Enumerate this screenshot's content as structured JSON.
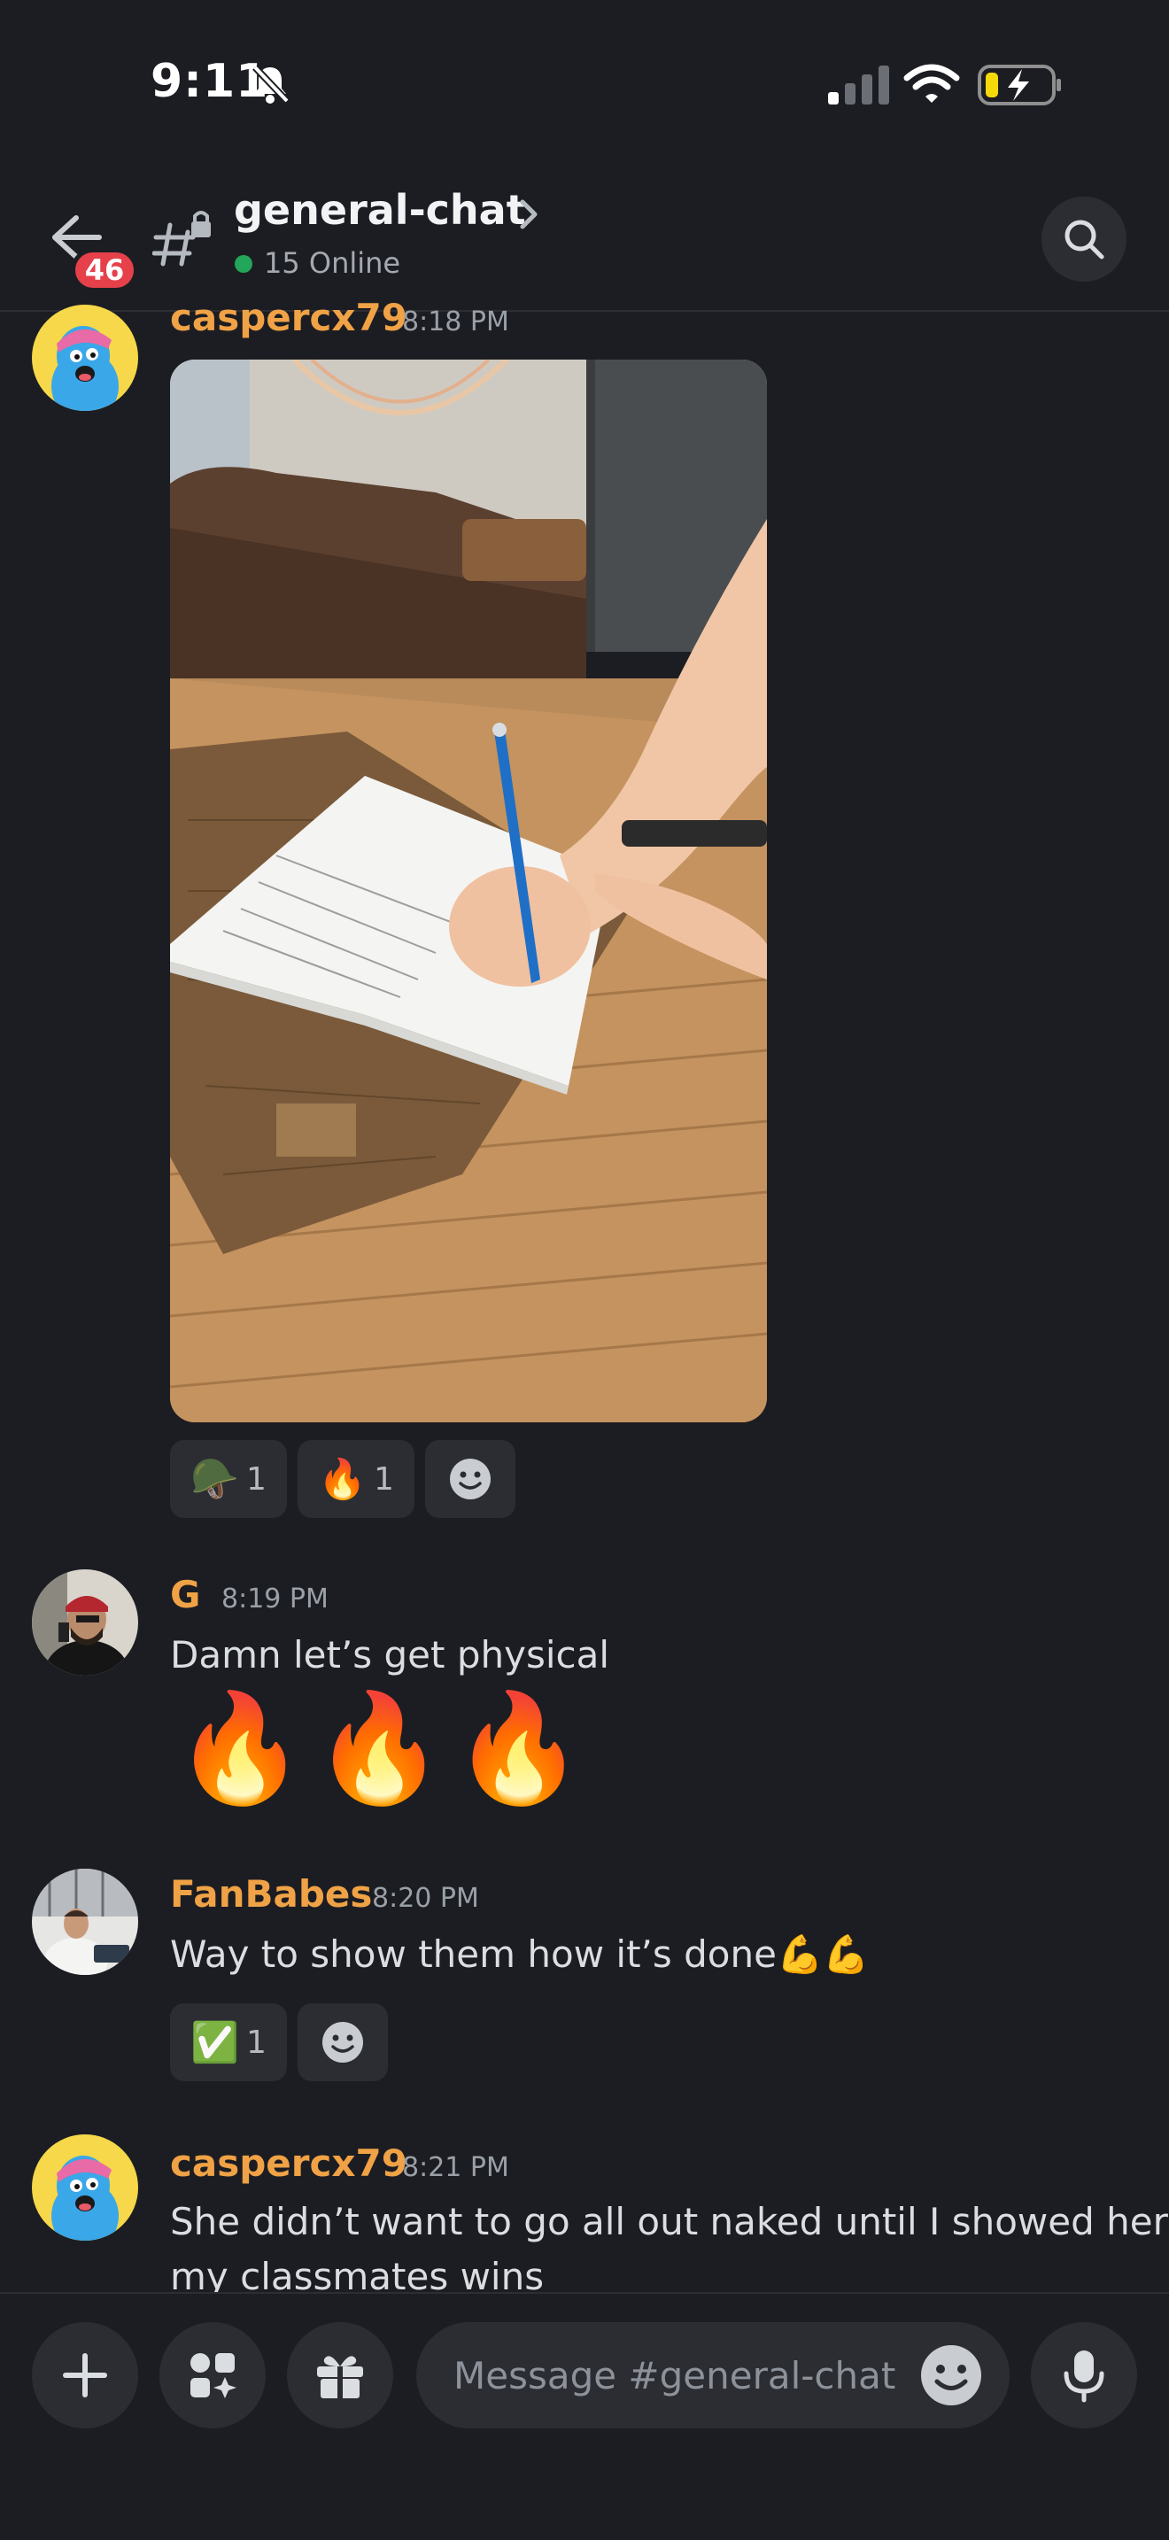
{
  "status_bar": {
    "time": "9:11"
  },
  "header": {
    "unread_badge": "46",
    "channel_name": "general-chat",
    "online_text": "15 Online"
  },
  "messages": [
    {
      "username": "caspercx79",
      "time": "8:18 PM",
      "reactions": [
        {
          "emoji": "🪖",
          "count": "1"
        },
        {
          "emoji": "🔥",
          "count": "1"
        }
      ]
    },
    {
      "username": "G",
      "time": "8:19 PM",
      "text": "Damn let’s get physical",
      "big_emoji": "🔥🔥🔥"
    },
    {
      "username": "FanBabes",
      "time": "8:20 PM",
      "text": "Way to show them how it’s done💪💪",
      "reactions": [
        {
          "emoji": "✅",
          "count": "1"
        }
      ]
    },
    {
      "username": "caspercx79",
      "time": "8:21 PM",
      "text_line1": "She didn’t want to go all out naked until I showed her",
      "text_line2": "my classmates wins"
    }
  ],
  "composer": {
    "placeholder": "Message #general-chat"
  },
  "colors": {
    "background": "#1c1d22",
    "username": "#f0a246",
    "online": "#23a55a",
    "badge": "#e6404a"
  },
  "icons": [
    "bell-slash-icon",
    "signal-icon",
    "wifi-icon",
    "battery-charging-icon",
    "back-arrow-icon",
    "hash-lock-icon",
    "chevron-right-icon",
    "search-icon",
    "plus-icon",
    "apps-icon",
    "gift-icon",
    "emoji-icon",
    "microphone-icon",
    "add-reaction-icon"
  ]
}
